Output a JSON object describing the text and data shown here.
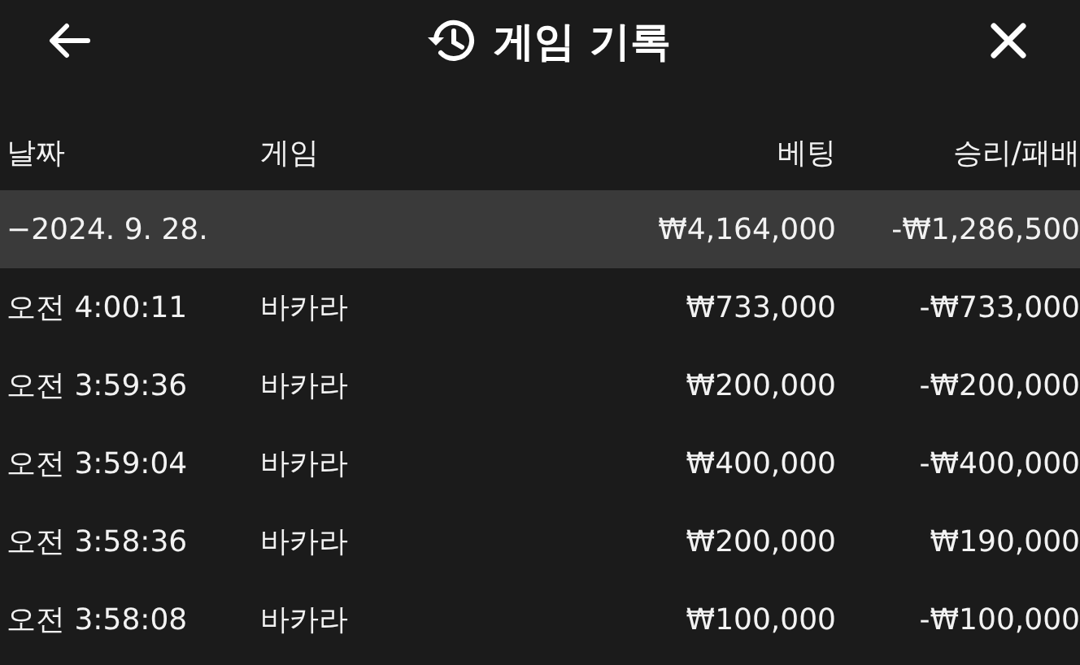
{
  "header": {
    "title": "게임 기록"
  },
  "table": {
    "columns": [
      "날짜",
      "게임",
      "베팅",
      "승리/패배"
    ],
    "group": {
      "date": "−2024. 9. 28.",
      "bet": "₩4,164,000",
      "result": "-₩1,286,500"
    },
    "rows": [
      {
        "time": "오전 4:00:11",
        "game": "바카라",
        "bet": "₩733,000",
        "result": "-₩733,000"
      },
      {
        "time": "오전 3:59:36",
        "game": "바카라",
        "bet": "₩200,000",
        "result": "-₩200,000"
      },
      {
        "time": "오전 3:59:04",
        "game": "바카라",
        "bet": "₩400,000",
        "result": "-₩400,000"
      },
      {
        "time": "오전 3:58:36",
        "game": "바카라",
        "bet": "₩200,000",
        "result": "₩190,000"
      },
      {
        "time": "오전 3:58:08",
        "game": "바카라",
        "bet": "₩100,000",
        "result": "-₩100,000"
      }
    ]
  }
}
